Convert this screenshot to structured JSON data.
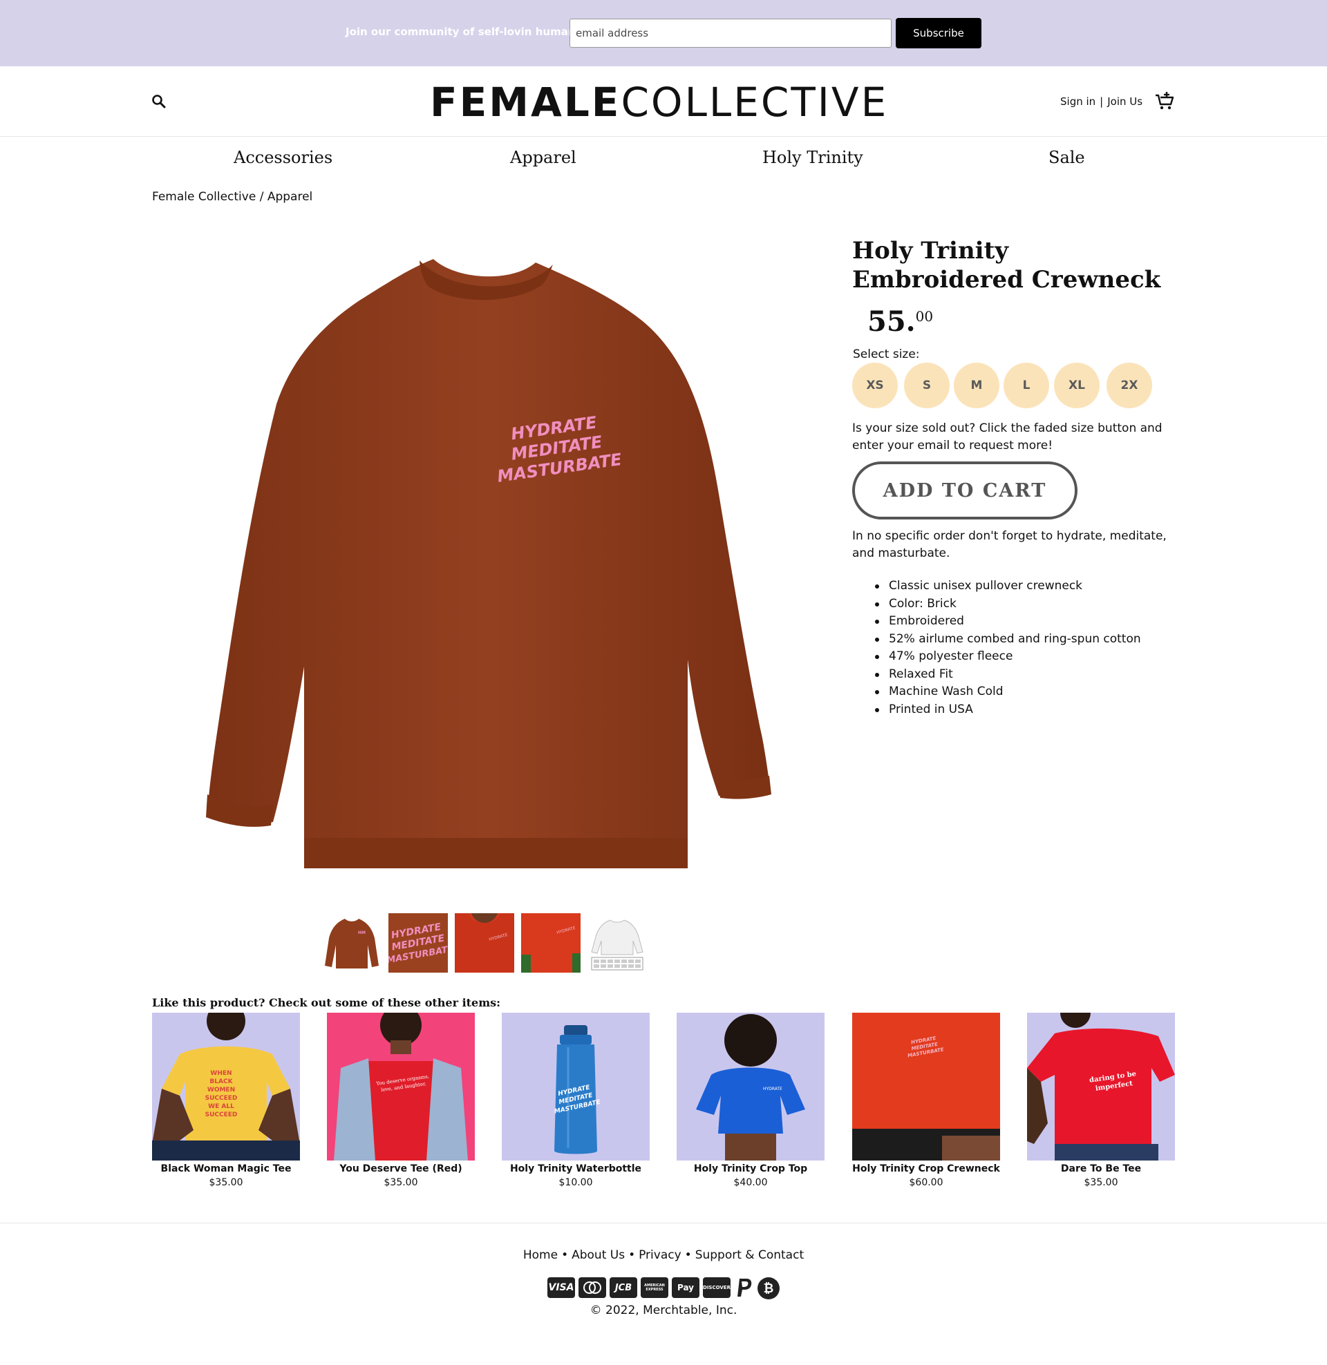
{
  "promo": {
    "text": "Join our community of self-lovin humans.",
    "email_placeholder": "email address",
    "subscribe_label": "Subscribe"
  },
  "header": {
    "logo_part1": "FEMALE",
    "logo_part2": "COLLECTIVE",
    "sign_in": "Sign in",
    "separator": "|",
    "join_us": "Join Us"
  },
  "nav": {
    "items": [
      "Accessories",
      "Apparel",
      "Holy Trinity",
      "Sale"
    ]
  },
  "breadcrumb": "Female Collective / Apparel",
  "product": {
    "title": "Holy Trinity Embroidered Crewneck",
    "price_main": "55.",
    "price_cents": "00",
    "select_size_label": "Select size:",
    "sizes": [
      "XS",
      "S",
      "M",
      "L",
      "XL",
      "2X"
    ],
    "sold_out_note": "Is your size sold out? Click the faded size button and enter your email to request more!",
    "add_to_cart": "ADD TO CART",
    "description": "In no specific order don't forget to hydrate, meditate, and masturbate.",
    "features": [
      "Classic unisex pullover crewneck",
      "Color: Brick",
      "Embroidered",
      "52% airlume combed and ring-spun cotton",
      "47% polyester fleece",
      "Relaxed Fit",
      "Machine Wash Cold",
      "Printed in USA"
    ],
    "print_lines": [
      "HYDRATE",
      "MEDITATE",
      "MASTURBATE"
    ],
    "colors": {
      "brick": "#8f3d1c",
      "print_pink": "#f08fc0"
    }
  },
  "related": {
    "title": "Like this product? Check out some of these other items:",
    "items": [
      {
        "name": "Black Woman Magic Tee",
        "price": "$35.00",
        "bg": "#c9c6ee",
        "garment": "#f5c842",
        "print": "WHEN BLACK WOMEN SUCCEED WE ALL SUCCEED"
      },
      {
        "name": "You Deserve Tee (Red)",
        "price": "$35.00",
        "bg": "#f2437a",
        "garment": "#e01d2a",
        "print": "You deserve orgasms, love, and laughter."
      },
      {
        "name": "Holy Trinity Waterbottle",
        "price": "$10.00",
        "bg": "#c9c6ee",
        "garment": "#1f6bb8",
        "print": "HYDRATE MEDITATE MASTURBATE"
      },
      {
        "name": "Holy Trinity Crop Top",
        "price": "$40.00",
        "bg": "#c9c6ee",
        "garment": "#1a5fd6",
        "print": ""
      },
      {
        "name": "Holy Trinity Crop Crewneck",
        "price": "$60.00",
        "bg": "#d93820",
        "garment": "#e23b1d",
        "print": "HYDRATE MEDITATE MASTURBATE"
      },
      {
        "name": "Dare To Be Tee",
        "price": "$35.00",
        "bg": "#c9c6ee",
        "garment": "#e8162b",
        "print": "daring to be imperfect"
      }
    ]
  },
  "footer": {
    "links": [
      "Home",
      "About Us",
      "Privacy",
      "Support & Contact"
    ],
    "link_separator": "•",
    "payments": [
      "VISA",
      "mastercard-icon",
      "JCB",
      "AMERICAN EXPRESS",
      "Pay",
      "DISCOVER",
      "paypal-icon",
      "bitcoin-icon"
    ],
    "copyright": "© 2022, Merchtable, Inc."
  }
}
